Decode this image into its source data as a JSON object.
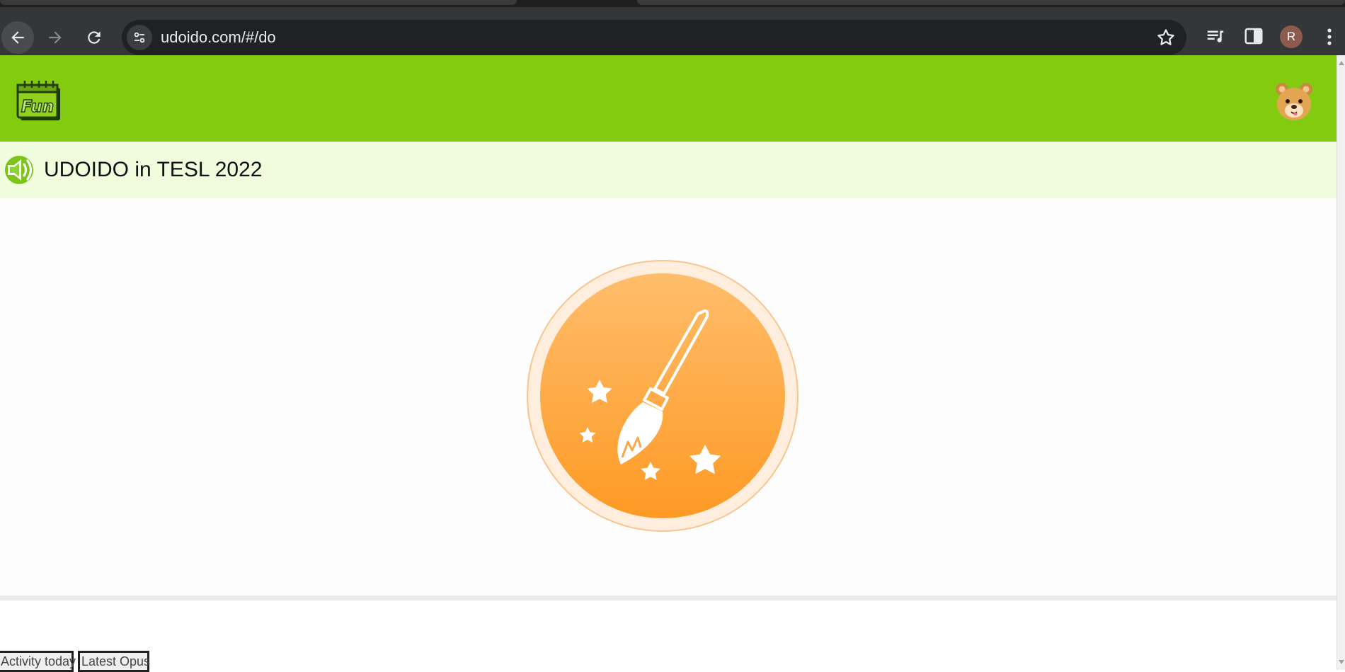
{
  "browser": {
    "url": "udoido.com/#/do",
    "profile_initial": "R",
    "icons": {
      "back": "arrow-left-icon",
      "forward": "arrow-right-icon",
      "reload": "reload-icon",
      "site_info": "tune-icon",
      "bookmark": "star-icon",
      "media": "playlist-icon",
      "side_panel": "side-panel-icon",
      "menu": "kebab-menu-icon"
    }
  },
  "header": {
    "logo_text": "Fun",
    "colors": {
      "header_bg": "#82cb0f",
      "title_bar_bg": "#f0fddd"
    }
  },
  "title_bar": {
    "title": "UDOIDO in TESL 2022",
    "icon": "speaker-icon"
  },
  "main": {
    "medal_icon": "paintbrush-stars-icon",
    "colors": {
      "medal_top": "#ffbd6b",
      "medal_bottom": "#fe9a25"
    }
  },
  "footer": {
    "tabs": [
      {
        "label": "Activity today"
      },
      {
        "label": "Latest Opus"
      }
    ]
  }
}
